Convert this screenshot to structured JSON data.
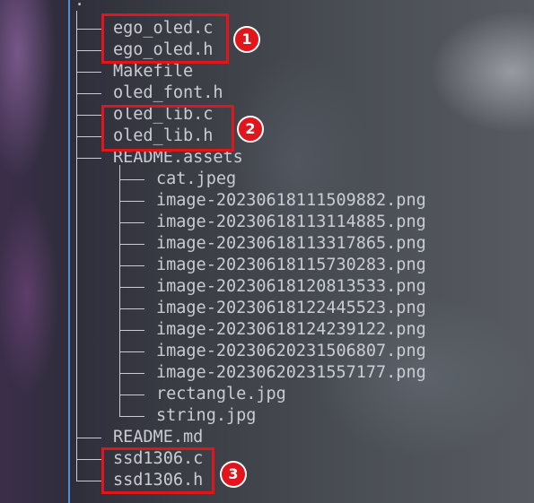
{
  "tree": {
    "root_label": ".",
    "entries": [
      {
        "name": "ego_oled.c"
      },
      {
        "name": "ego_oled.h"
      },
      {
        "name": "Makefile"
      },
      {
        "name": "oled_font.h"
      },
      {
        "name": "oled_lib.c"
      },
      {
        "name": "oled_lib.h"
      },
      {
        "name": "README.assets"
      },
      {
        "name": "cat.jpeg"
      },
      {
        "name": "image-20230618111509882.png"
      },
      {
        "name": "image-20230618113114885.png"
      },
      {
        "name": "image-20230618113317865.png"
      },
      {
        "name": "image-20230618115730283.png"
      },
      {
        "name": "image-20230618120813533.png"
      },
      {
        "name": "image-20230618122445523.png"
      },
      {
        "name": "image-20230618124239122.png"
      },
      {
        "name": "image-20230620231506807.png"
      },
      {
        "name": "image-20230620231557177.png"
      },
      {
        "name": "rectangle.jpg"
      },
      {
        "name": "string.jpg"
      },
      {
        "name": "README.md"
      },
      {
        "name": "ssd1306.c"
      },
      {
        "name": "ssd1306.h"
      }
    ]
  },
  "annotations": {
    "badge_1": "1",
    "badge_2": "2",
    "badge_3": "3",
    "highlight_color": "#e0161c"
  }
}
